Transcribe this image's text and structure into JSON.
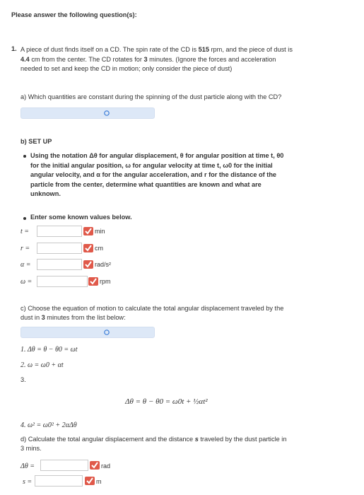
{
  "header": {
    "title": "Please answer the following question(s):"
  },
  "question": {
    "number": "1.",
    "text_1": "A piece of dust finds itself on a CD. The spin rate of the CD is ",
    "spin_rate": "515",
    "text_2": " rpm, and the piece of dust is",
    "distance": "4.4",
    "text_3": " cm from the center. The CD rotates for ",
    "minutes": "3",
    "text_4": " minutes. (Ignore the forces and acceleration",
    "text_5": "needed to set and keep the CD in motion; only consider the piece of dust)"
  },
  "part_a": {
    "prompt": "a) Which quantities are constant during the spinning of the dust particle along with the CD?"
  },
  "part_b": {
    "heading": "b) SET UP",
    "bullet_1_lines": [
      "Using the notation Δθ for angular displacement, θ for angular position at time t, θ0",
      "for the initial angular position, ω for angular velocity at time t, ω0 for the initial",
      "angular velocity, and α for the angular acceleration, and r for the distance of the",
      "particle from the center, determine what quantities are known and what are",
      "unknown."
    ],
    "bullet_2": "Enter some known values below.",
    "fields": [
      {
        "label": "t =",
        "value": "",
        "unit": "min"
      },
      {
        "label": "r =",
        "value": "",
        "unit": "cm"
      },
      {
        "label": "α =",
        "value": "",
        "unit": "rad/s²"
      },
      {
        "label": "ω =",
        "value": "",
        "unit": "rpm"
      }
    ]
  },
  "part_c": {
    "prompt_1": "c) Choose the equation of motion to calculate the total angular displacement traveled by the",
    "prompt_2a": "dust in ",
    "prompt_2b": "3",
    "prompt_2c": " minutes from the list below:",
    "eq1": "1. Δθ = θ − θ0 = ωt",
    "eq2": "2. ω = ω0 + αt",
    "eq3_num": "3.",
    "eq3": "Δθ = θ − θ0 = ω0t + ½αt²",
    "eq4": "4. ω² = ω0² + 2αΔθ"
  },
  "part_d": {
    "prompt_1a": "d) Calculate the total angular displacement and the distance ",
    "prompt_1b": "s",
    "prompt_1c": " traveled by the dust particle in",
    "prompt_2": "3 mins.",
    "fields": [
      {
        "label": "Δθ =",
        "value": "",
        "unit": "rad"
      },
      {
        "label": "s =",
        "value": "",
        "unit": "m"
      }
    ]
  },
  "colors": {
    "select_bg": "#dde8f7",
    "check_red": "#e0594a",
    "chevron_blue": "#3b7dd8"
  }
}
